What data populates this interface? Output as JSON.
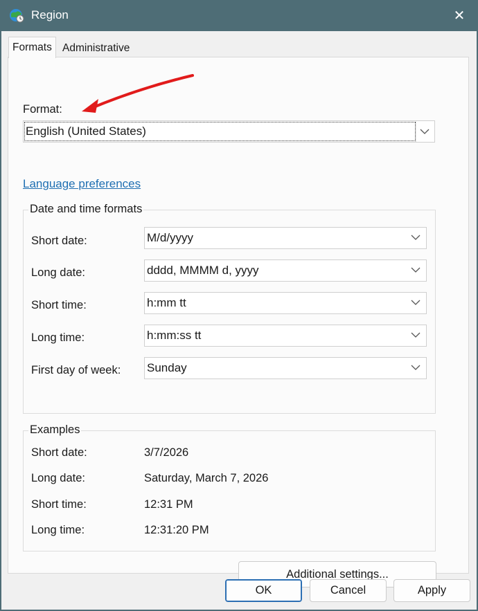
{
  "window": {
    "title": "Region",
    "close_glyph": "✕"
  },
  "tabs": [
    {
      "label": "Formats"
    },
    {
      "label": "Administrative"
    }
  ],
  "format": {
    "label": "Format:",
    "value": "English (United States)"
  },
  "language_link": "Language preferences",
  "date_time": {
    "title": "Date and time formats",
    "rows": [
      {
        "label": "Short date:",
        "value": "M/d/yyyy"
      },
      {
        "label": "Long date:",
        "value": "dddd, MMMM d, yyyy"
      },
      {
        "label": "Short time:",
        "value": "h:mm tt"
      },
      {
        "label": "Long time:",
        "value": "h:mm:ss tt"
      },
      {
        "label": "First day of week:",
        "value": "Sunday"
      }
    ]
  },
  "examples": {
    "title": "Examples",
    "rows": [
      {
        "label": "Short date:",
        "value": "3/7/2026"
      },
      {
        "label": "Long date:",
        "value": "Saturday, March 7, 2026"
      },
      {
        "label": "Short time:",
        "value": "12:31 PM"
      },
      {
        "label": "Long time:",
        "value": "12:31:20 PM"
      }
    ]
  },
  "buttons": {
    "additional": "Additional settings...",
    "ok": "OK",
    "cancel": "Cancel",
    "apply": "Apply"
  },
  "colors": {
    "titlebar": "#4e6d76",
    "link": "#1f6fb2",
    "annotation_arrow": "#e11b1b",
    "ok_border": "#2c6fb3"
  },
  "icons": {
    "app": "globe-clock-icon",
    "close": "close-icon",
    "chevron": "chevron-down-icon"
  }
}
